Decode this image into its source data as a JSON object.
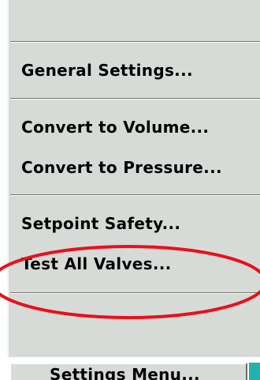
{
  "menu": {
    "items": [
      {
        "label": "General Settings..."
      },
      {
        "label": "Convert to Volume..."
      },
      {
        "label": "Convert to Pressure..."
      },
      {
        "label": "Setpoint Safety..."
      },
      {
        "label": "Test All Valves..."
      }
    ]
  },
  "footer": {
    "settings_menu_label": "Settings Menu..."
  },
  "colors": {
    "menu_background": "#d7dbd8",
    "highlight_ellipse": "#e8101c",
    "accent_strip": "#1fb3b0"
  },
  "annotation": {
    "highlighted_item": "Test All Valves..."
  }
}
